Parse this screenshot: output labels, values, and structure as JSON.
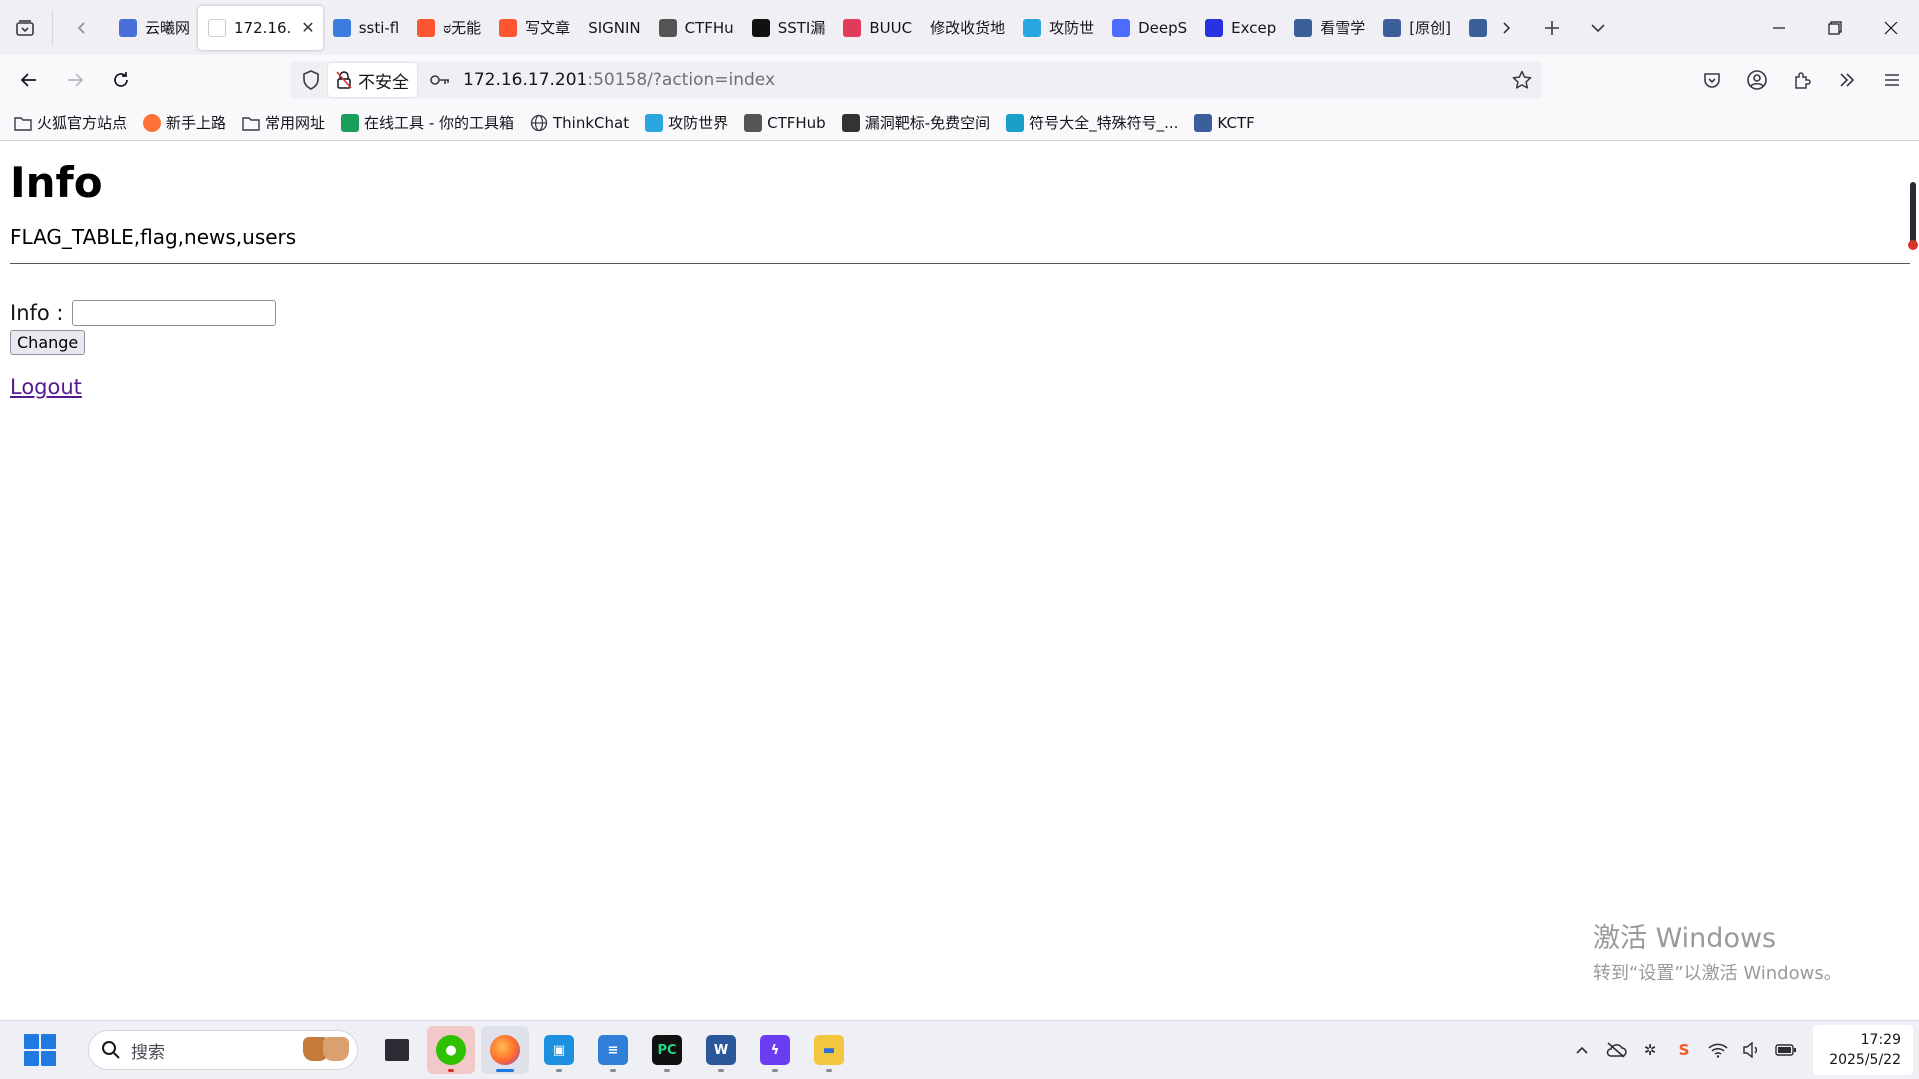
{
  "browser": {
    "tabs": [
      {
        "label": "云曦网",
        "icon": "yunxi-favicon",
        "color": "#4a6fd6",
        "active": false
      },
      {
        "label": "172.16.",
        "icon": "page-favicon",
        "color": "#ffffff",
        "active": true
      },
      {
        "label": "ssti-fl",
        "icon": "ssti-favicon",
        "color": "#3c7be0",
        "active": false
      },
      {
        "label": "ಠ无能",
        "icon": "csdn-favicon",
        "color": "#fc5531",
        "active": false
      },
      {
        "label": "写文章",
        "icon": "csdn-favicon",
        "color": "#fc5531",
        "active": false
      },
      {
        "label": "SIGNIN",
        "icon": "",
        "color": "",
        "active": false
      },
      {
        "label": "CTFHu",
        "icon": "ctfhub-favicon",
        "color": "#555555",
        "active": false
      },
      {
        "label": "SSTI漏",
        "icon": "k-favicon",
        "color": "#111111",
        "active": false
      },
      {
        "label": "BUUC",
        "icon": "buuctf-favicon",
        "color": "#e03c5a",
        "active": false
      },
      {
        "label": "修改收货地",
        "icon": "",
        "color": "",
        "active": false
      },
      {
        "label": "攻防世",
        "icon": "adworld-favicon",
        "color": "#2aa7e0",
        "active": false
      },
      {
        "label": "DeepS",
        "icon": "deepseek-favicon",
        "color": "#4d6bfe",
        "active": false
      },
      {
        "label": "Excep",
        "icon": "baidu-favicon",
        "color": "#2932e1",
        "active": false
      },
      {
        "label": "看雪学",
        "icon": "kanxue-favicon",
        "color": "#3a5f9a",
        "active": false
      },
      {
        "label": "[原创]",
        "icon": "kanxue-favicon",
        "color": "#3a5f9a",
        "active": false
      },
      {
        "label": "",
        "icon": "kanxue-favicon",
        "color": "#3a5f9a",
        "active": false
      }
    ],
    "url": {
      "security_label": "不安全",
      "host": "172.16.17.201",
      "rest": ":50158/?action=index"
    },
    "bookmarks": [
      {
        "label": "火狐官方站点",
        "icon": "folder-icon"
      },
      {
        "label": "新手上路",
        "icon": "firefox-icon"
      },
      {
        "label": "常用网址",
        "icon": "folder-icon"
      },
      {
        "label": "在线工具 - 你的工具箱",
        "icon": "tool-icon"
      },
      {
        "label": "ThinkChat",
        "icon": "globe-icon"
      },
      {
        "label": "攻防世界",
        "icon": "adworld-icon"
      },
      {
        "label": "CTFHub",
        "icon": "ctfhub-icon"
      },
      {
        "label": "漏洞靶标-免费空间",
        "icon": "vuln-icon"
      },
      {
        "label": "符号大全_特殊符号_...",
        "icon": "ke-icon"
      },
      {
        "label": "KCTF",
        "icon": "kanxue-icon"
      }
    ]
  },
  "page": {
    "title": "Info",
    "tables": "FLAG_TABLE,flag,news,users",
    "info_label": "Info :",
    "info_value": "",
    "change_button": "Change",
    "logout_link": "Logout"
  },
  "watermark": {
    "title": "激活 Windows",
    "subtitle": "转到“设置”以激活 Windows。"
  },
  "taskbar": {
    "search_placeholder": "搜索",
    "clock_time": "17:29",
    "clock_date": "2025/5/22"
  }
}
